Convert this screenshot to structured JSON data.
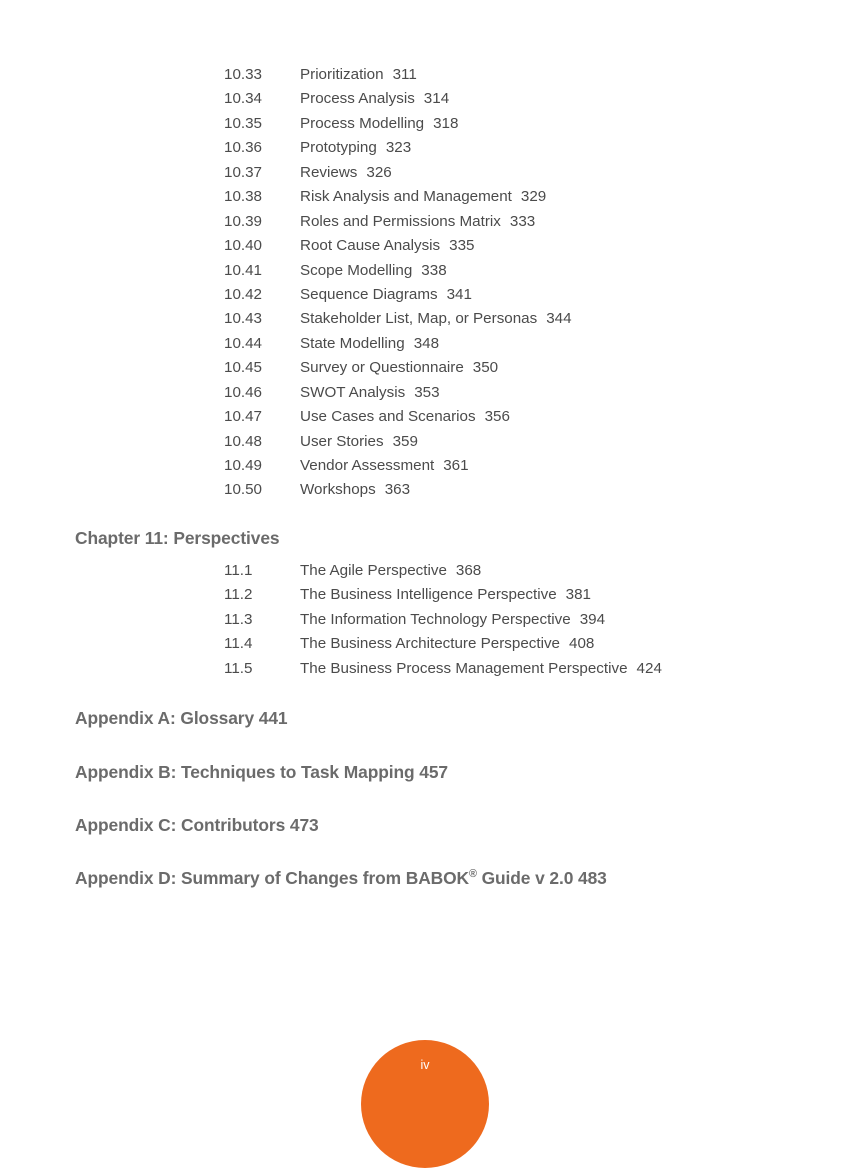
{
  "page": {
    "folio": "iv",
    "folio_color": "#ee6a1e",
    "folio_text_color": "#ffffff",
    "text_color": "#4b4b4b",
    "heading_color": "#6b6b6b",
    "background": "#ffffff"
  },
  "chapter_10_entries": [
    {
      "num": "10.33",
      "title": "Prioritization",
      "page": "311"
    },
    {
      "num": "10.34",
      "title": "Process Analysis",
      "page": "314"
    },
    {
      "num": "10.35",
      "title": "Process Modelling",
      "page": "318"
    },
    {
      "num": "10.36",
      "title": "Prototyping",
      "page": "323"
    },
    {
      "num": "10.37",
      "title": "Reviews",
      "page": "326"
    },
    {
      "num": "10.38",
      "title": "Risk Analysis and Management",
      "page": "329"
    },
    {
      "num": "10.39",
      "title": "Roles and Permissions Matrix",
      "page": "333"
    },
    {
      "num": "10.40",
      "title": "Root Cause Analysis",
      "page": "335"
    },
    {
      "num": "10.41",
      "title": "Scope Modelling",
      "page": "338"
    },
    {
      "num": "10.42",
      "title": "Sequence Diagrams",
      "page": "341"
    },
    {
      "num": "10.43",
      "title": "Stakeholder List, Map, or Personas",
      "page": "344"
    },
    {
      "num": "10.44",
      "title": "State Modelling",
      "page": "348"
    },
    {
      "num": "10.45",
      "title": "Survey or Questionnaire",
      "page": "350"
    },
    {
      "num": "10.46",
      "title": "SWOT Analysis",
      "page": "353"
    },
    {
      "num": "10.47",
      "title": "Use Cases and Scenarios",
      "page": "356"
    },
    {
      "num": "10.48",
      "title": "User Stories",
      "page": "359"
    },
    {
      "num": "10.49",
      "title": "Vendor Assessment",
      "page": "361"
    },
    {
      "num": "10.50",
      "title": "Workshops",
      "page": "363"
    }
  ],
  "chapter_11": {
    "heading": "Chapter 11: Perspectives",
    "entries": [
      {
        "num": "11.1",
        "title": "The Agile Perspective",
        "page": "368"
      },
      {
        "num": "11.2",
        "title": "The Business Intelligence Perspective",
        "page": "381"
      },
      {
        "num": "11.3",
        "title": "The Information Technology Perspective",
        "page": "394"
      },
      {
        "num": "11.4",
        "title": "The Business Architecture Perspective",
        "page": "408"
      },
      {
        "num": "11.5",
        "title": "The Business Process Management Perspective",
        "page": "424"
      }
    ]
  },
  "appendices": {
    "a": "Appendix A: Glossary 441",
    "b": "Appendix B: Techniques to Task Mapping 457",
    "c": "Appendix C: Contributors 473",
    "d_before": "Appendix D: Summary of Changes from BABOK",
    "d_sup": "®",
    "d_after": " Guide v 2.0 483"
  }
}
